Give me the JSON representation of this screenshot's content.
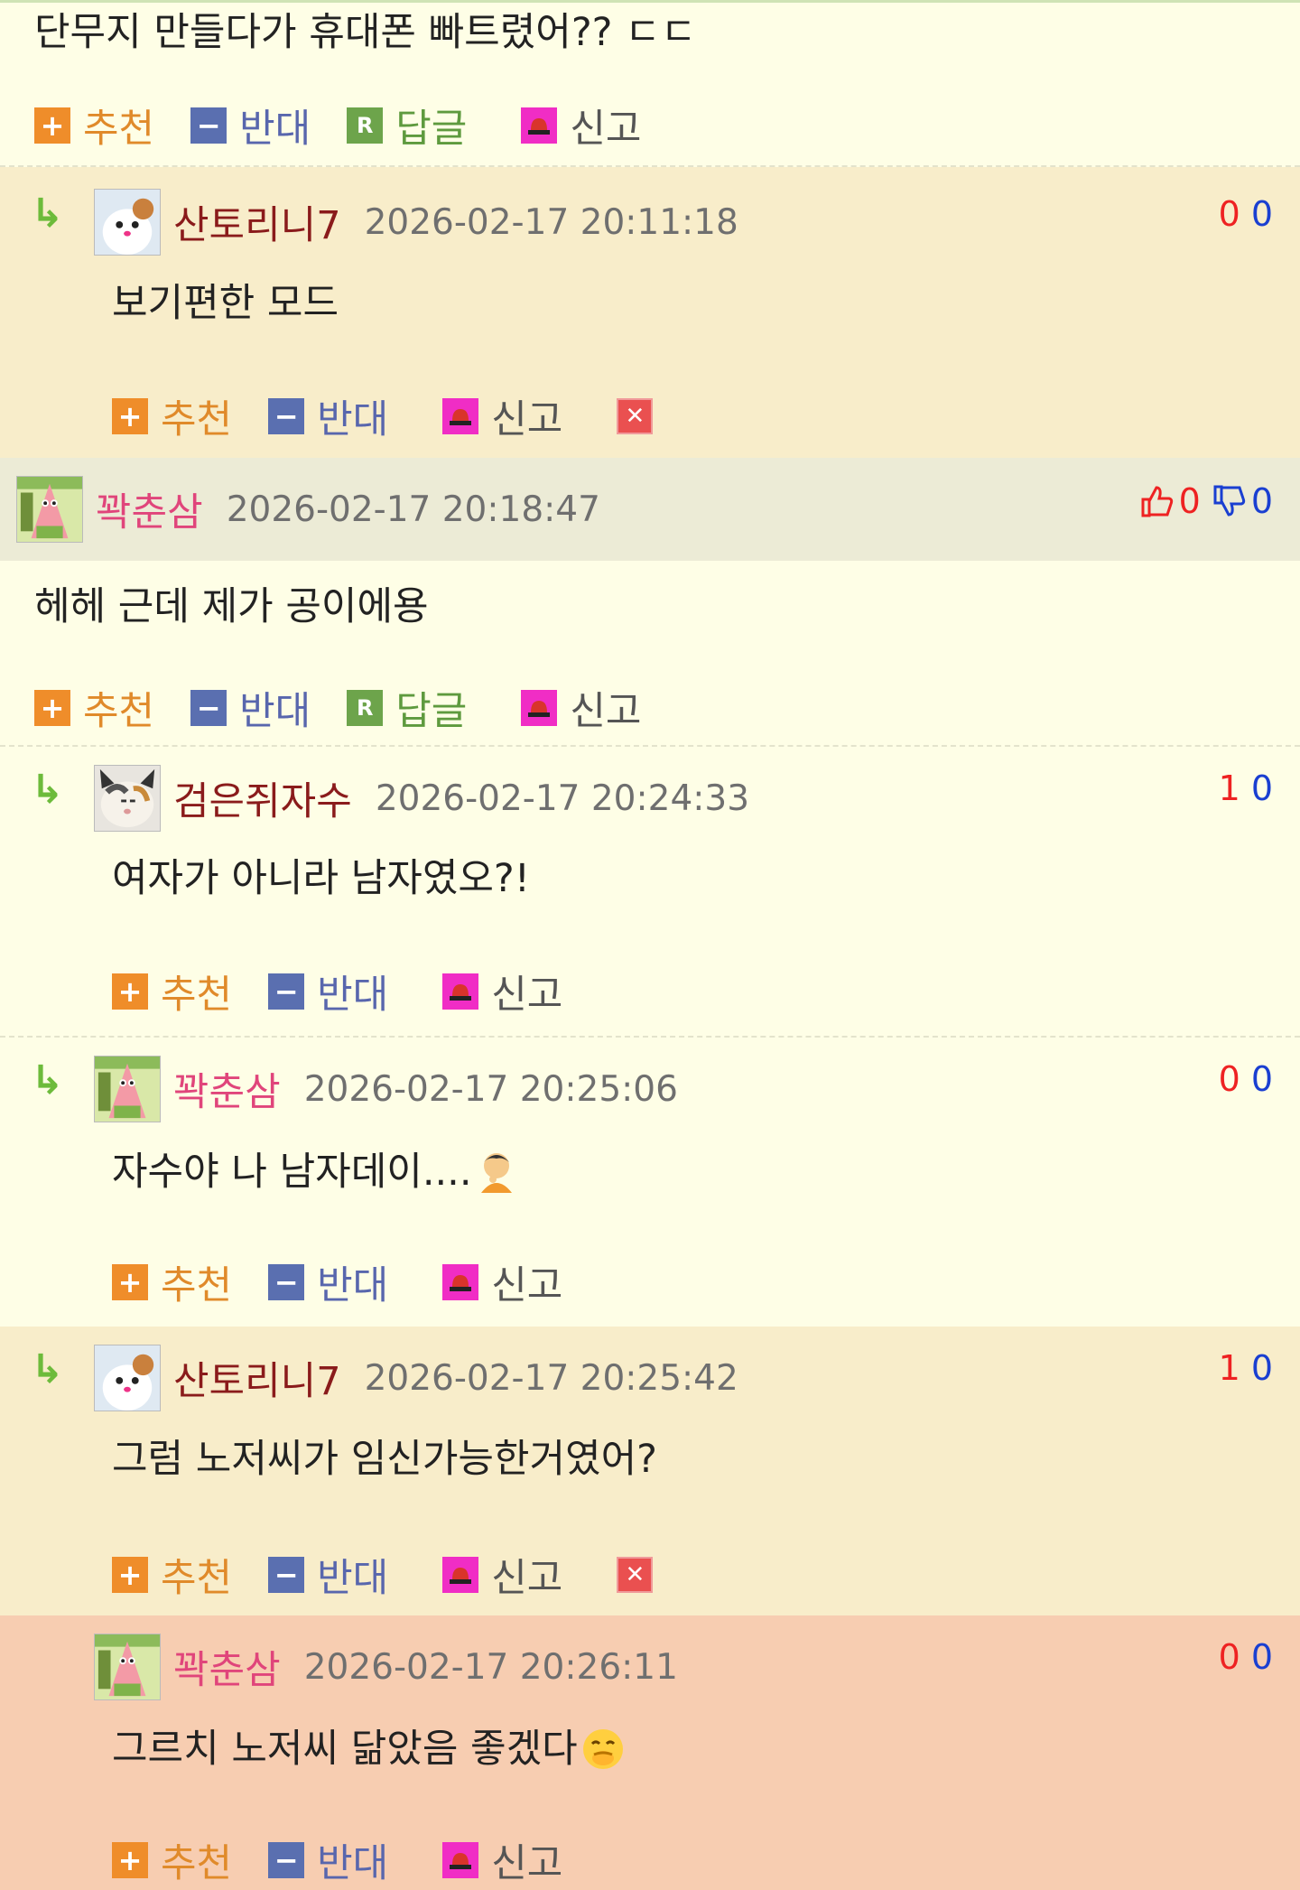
{
  "c0": {
    "content": "단무지 만들다가 휴대폰 빠트렸어?? ㄷㄷ",
    "actions": {
      "recommend": "추천",
      "oppose": "반대",
      "reply": "답글",
      "report": "신고"
    }
  },
  "c1": {
    "nick": "산토리니7",
    "date": "2026-02-17 20:11:18",
    "up": "0",
    "down": "0",
    "content": "보기편한 모드",
    "actions": {
      "recommend": "추천",
      "oppose": "반대",
      "report": "신고"
    }
  },
  "c2": {
    "nick": "꽉춘삼",
    "date": "2026-02-17 20:18:47",
    "up": "0",
    "down": "0",
    "content": "헤헤 근데 제가 공이에용",
    "actions": {
      "recommend": "추천",
      "oppose": "반대",
      "reply": "답글",
      "report": "신고"
    }
  },
  "c3": {
    "nick": "검은쥐자수",
    "date": "2026-02-17 20:24:33",
    "up": "1",
    "down": "0",
    "content": "여자가 아니라 남자였오?!",
    "actions": {
      "recommend": "추천",
      "oppose": "반대",
      "report": "신고"
    }
  },
  "c4": {
    "nick": "꽉춘삼",
    "date": "2026-02-17 20:25:06",
    "up": "0",
    "down": "0",
    "content": "자수야 나 남자데이....",
    "actions": {
      "recommend": "추천",
      "oppose": "반대",
      "report": "신고"
    }
  },
  "c5": {
    "nick": "산토리니7",
    "date": "2026-02-17 20:25:42",
    "up": "1",
    "down": "0",
    "content": "그럼 노저씨가 임신가능한거였어?",
    "actions": {
      "recommend": "추천",
      "oppose": "반대",
      "report": "신고"
    }
  },
  "c6": {
    "nick": "꽉춘삼",
    "date": "2026-02-17 20:26:11",
    "up": "0",
    "down": "0",
    "content": "그르치 노저씨 닮았음 좋겠다",
    "actions": {
      "recommend": "추천",
      "oppose": "반대",
      "report": "신고"
    }
  },
  "colors": {
    "up": "#ee2222",
    "down": "#1a3fd1",
    "beige": "#f8edca",
    "peach": "#f7cdb1",
    "yellow": "#fefee6"
  }
}
